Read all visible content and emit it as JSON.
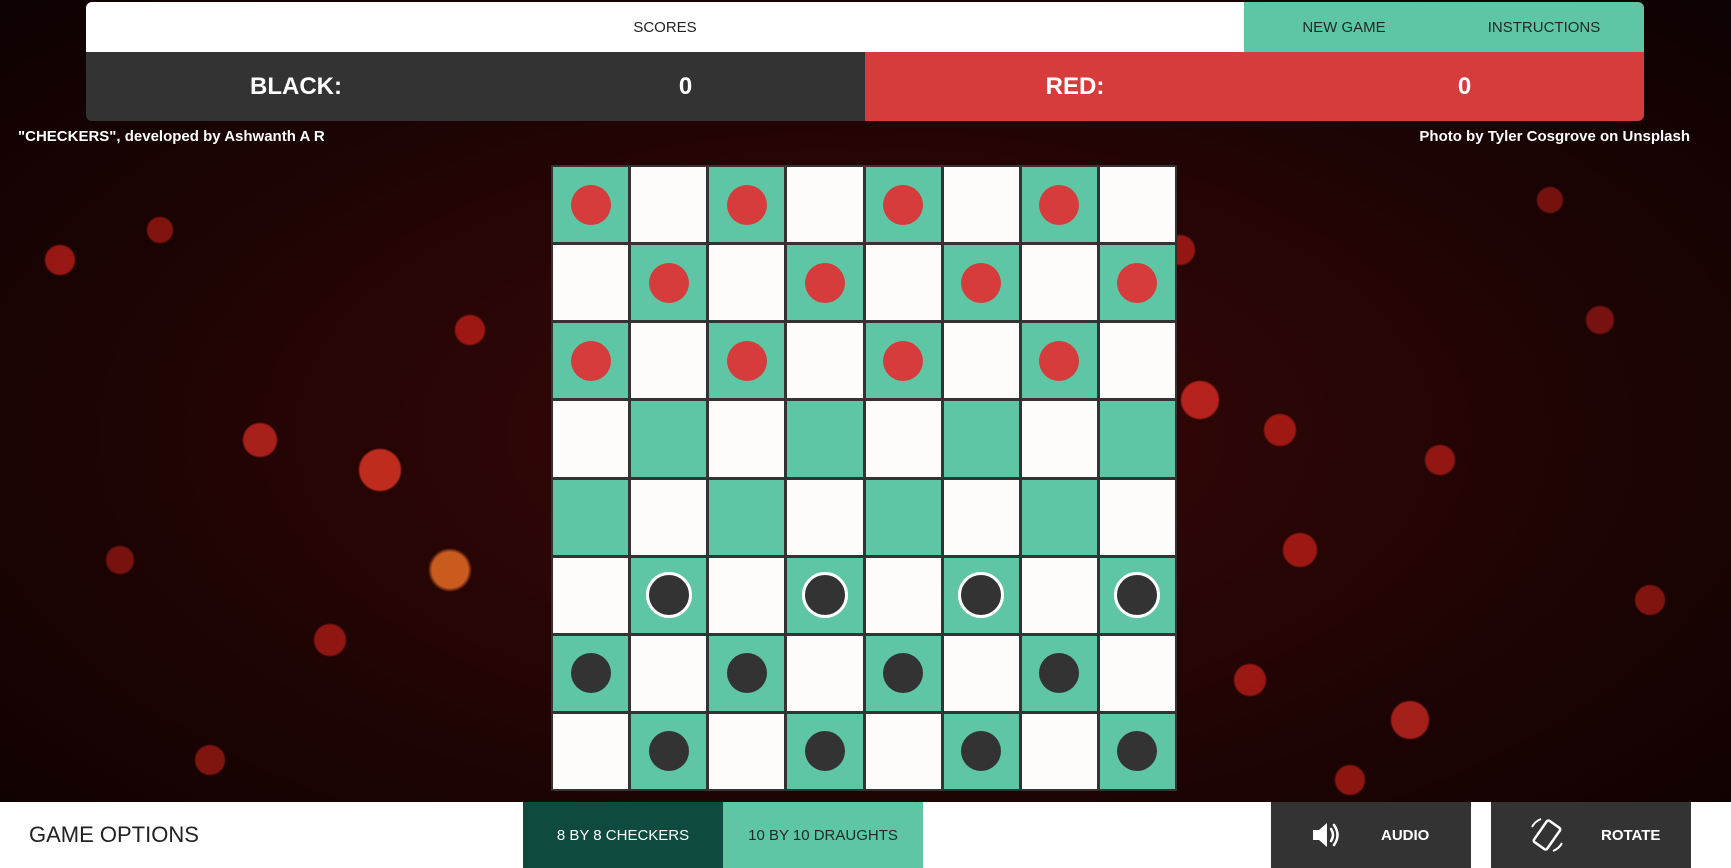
{
  "header": {
    "scores_label": "SCORES",
    "new_game_label": "NEW GAME",
    "instructions_label": "INSTRUCTIONS"
  },
  "scores": {
    "black_label": "BLACK:",
    "black_value": "0",
    "red_label": "RED:",
    "red_value": "0"
  },
  "credits": {
    "left": "\"CHECKERS\", developed by Ashwanth A R",
    "right": "Photo by Tyler Cosgrove on Unsplash"
  },
  "board": {
    "size": 8,
    "rows": [
      [
        "red",
        "",
        "red",
        "",
        "red",
        "",
        "red",
        ""
      ],
      [
        "",
        "red",
        "",
        "red",
        "",
        "red",
        "",
        "red"
      ],
      [
        "red",
        "",
        "red",
        "",
        "red",
        "",
        "red",
        ""
      ],
      [
        "",
        "",
        "",
        "",
        "",
        "",
        "",
        ""
      ],
      [
        "",
        "",
        "",
        "",
        "",
        "",
        "",
        ""
      ],
      [
        "",
        "black-movable",
        "",
        "black-movable",
        "",
        "black-movable",
        "",
        "black-movable"
      ],
      [
        "black",
        "",
        "black",
        "",
        "black",
        "",
        "black",
        ""
      ],
      [
        "",
        "black",
        "",
        "black",
        "",
        "black",
        "",
        "black"
      ]
    ],
    "colors": {
      "dark_square": "#5ec6a4",
      "light_square": "#fdfcfa",
      "red_piece": "#d63c3b",
      "black_piece": "#333333"
    }
  },
  "footer": {
    "options_title": "GAME OPTIONS",
    "mode_8": "8 BY 8 CHECKERS",
    "mode_10": "10 BY 10 DRAUGHTS",
    "audio_label": "AUDIO",
    "audio_icon": "speaker-icon",
    "rotate_label": "ROTATE",
    "rotate_icon": "rotate-icon"
  }
}
